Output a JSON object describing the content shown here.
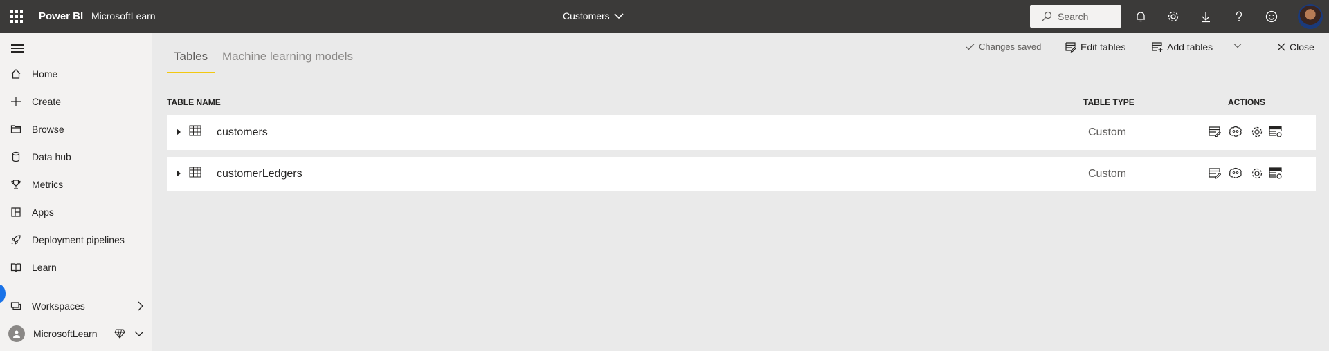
{
  "topbar": {
    "app_name": "Power BI",
    "workspace": "MicrosoftLearn",
    "doc_title": "Customers",
    "search_placeholder": "Search"
  },
  "sidebar": {
    "items": [
      {
        "label": "Home",
        "icon": "home-icon"
      },
      {
        "label": "Create",
        "icon": "plus-icon"
      },
      {
        "label": "Browse",
        "icon": "folder-icon"
      },
      {
        "label": "Data hub",
        "icon": "database-icon"
      },
      {
        "label": "Metrics",
        "icon": "trophy-icon"
      },
      {
        "label": "Apps",
        "icon": "apps-icon"
      },
      {
        "label": "Deployment pipelines",
        "icon": "rocket-icon"
      },
      {
        "label": "Learn",
        "icon": "book-icon"
      }
    ],
    "workspaces_label": "Workspaces",
    "current_workspace": "MicrosoftLearn"
  },
  "main": {
    "tabs": [
      "Tables",
      "Machine learning models"
    ],
    "active_tab": "Tables",
    "status": "Changes saved",
    "commands": {
      "edit_tables": "Edit tables",
      "add_tables": "Add tables",
      "close": "Close"
    },
    "table": {
      "columns": [
        "TABLE NAME",
        "TABLE TYPE",
        "ACTIONS"
      ],
      "rows": [
        {
          "name": "customers",
          "type": "Custom"
        },
        {
          "name": "customerLedgers",
          "type": "Custom"
        }
      ]
    }
  },
  "colors": {
    "topbar": "#3b3a39",
    "accent_underline": "#f2c811",
    "sidebar_bg": "#f3f2f1",
    "content_bg": "#eaeaea"
  }
}
